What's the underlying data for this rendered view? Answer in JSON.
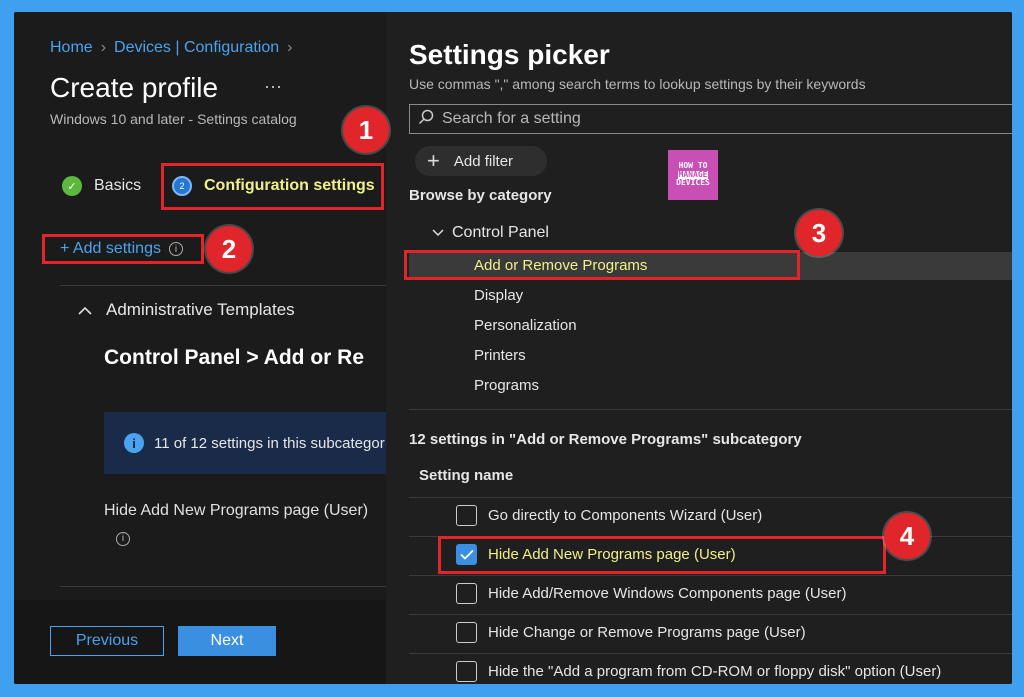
{
  "breadcrumb": {
    "home": "Home",
    "devices": "Devices | Configuration"
  },
  "page": {
    "title": "Create profile",
    "more": "···",
    "subtitle": "Windows 10 and later - Settings catalog"
  },
  "steps": [
    {
      "num": "✓",
      "label": "Basics"
    },
    {
      "num": "2",
      "label": "Configuration settings"
    }
  ],
  "add_settings": "+ Add settings",
  "admin_templates": "Administrative Templates",
  "category_header": "Control Panel > Add or Re",
  "info_text": "11 of 12 settings in this subcategor",
  "left_setting": "Hide Add New Programs page (User)",
  "buttons": {
    "previous": "Previous",
    "next": "Next"
  },
  "picker": {
    "title": "Settings picker",
    "subtitle": "Use commas \",\" among search terms to lookup settings by their keywords",
    "search_placeholder": "Search for a setting",
    "add_filter": "Add filter",
    "browse": "Browse by category",
    "tree_root": "Control Panel",
    "categories": [
      "Add or Remove Programs",
      "Display",
      "Personalization",
      "Printers",
      "Programs"
    ],
    "count_text": "12 settings in \"Add or Remove Programs\" subcategory",
    "column": "Setting name",
    "settings": [
      {
        "label": "Go directly to Components Wizard (User)",
        "checked": false
      },
      {
        "label": "Hide Add New Programs page (User)",
        "checked": true
      },
      {
        "label": "Hide Add/Remove Windows Components page (User)",
        "checked": false
      },
      {
        "label": "Hide Change or Remove Programs page (User)",
        "checked": false
      },
      {
        "label": "Hide the \"Add a program from CD-ROM or floppy disk\" option (User)",
        "checked": false
      }
    ]
  },
  "logo": {
    "line1": "HOW TO",
    "line2": "MANAGE",
    "line3": "DEVICES"
  },
  "annotations": [
    "1",
    "2",
    "3",
    "4"
  ],
  "colors": {
    "accent": "#4aa3f0",
    "highlight_text": "#f1f08a",
    "annotation": "#e0252b"
  }
}
